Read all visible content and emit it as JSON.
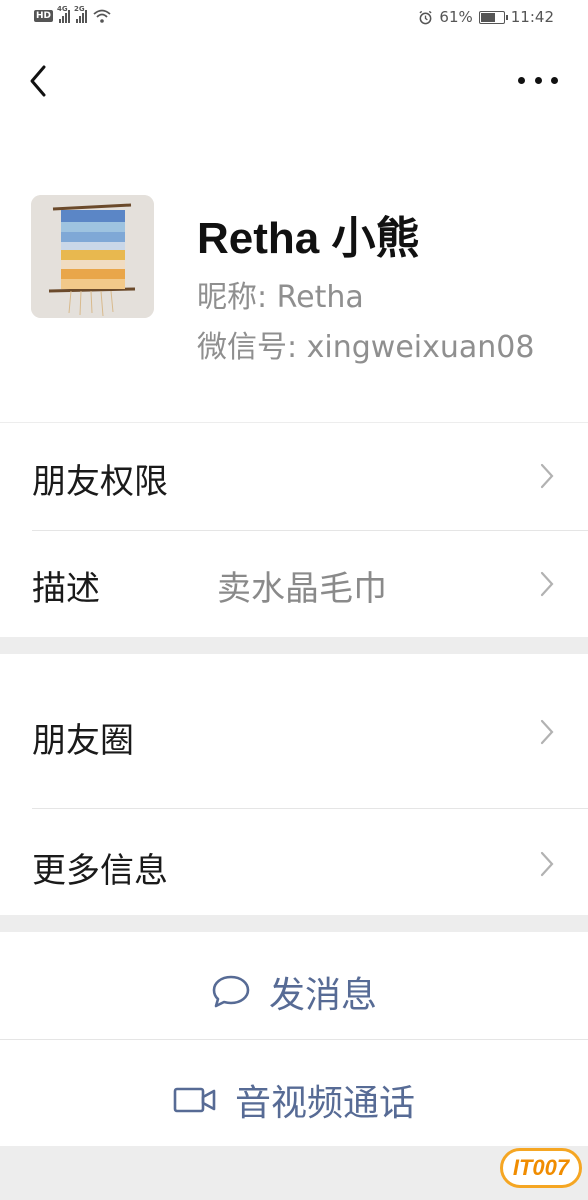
{
  "status_bar": {
    "network_1": "4G",
    "network_2": "2G",
    "battery": "61%",
    "time": "11:42"
  },
  "nav": {
    "back_icon": "chevron-left-icon",
    "more_icon": "more-horizontal-icon"
  },
  "profile": {
    "display_name": "Retha 小熊",
    "nickname": "昵称:  Retha",
    "wechat_id": "微信号:  xingweixuan08"
  },
  "group_1": {
    "rows": [
      {
        "label": "朋友权限",
        "value": ""
      },
      {
        "label": "描述",
        "value": "卖水晶毛巾"
      }
    ]
  },
  "group_2": {
    "rows": [
      {
        "label": "朋友圈"
      },
      {
        "label": "更多信息"
      }
    ]
  },
  "actions": {
    "message_label": "发消息",
    "call_label": "音视频通话"
  },
  "colors": {
    "link": "#576b95",
    "background": "#ededed"
  },
  "watermark": "IT007"
}
